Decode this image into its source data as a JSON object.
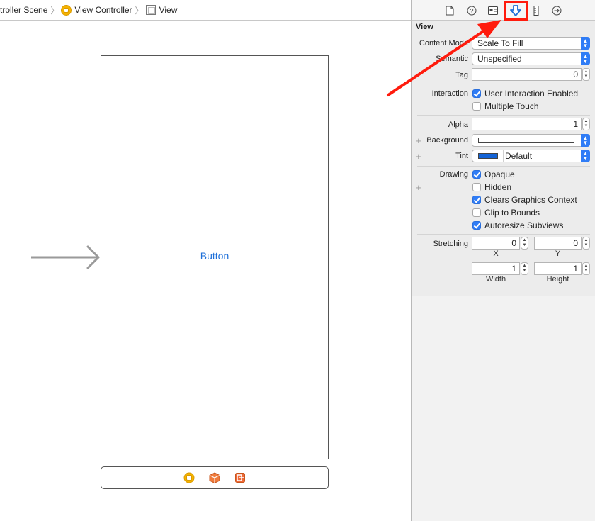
{
  "jumpbar": {
    "crumb_scene": "troller Scene",
    "crumb_vc": "View Controller",
    "crumb_view": "View",
    "separator": "〉"
  },
  "canvas": {
    "button_label": "Button"
  },
  "inspector": {
    "tabs": [
      "file-icon",
      "help-icon",
      "identity-icon",
      "attributes-icon",
      "size-icon",
      "connections-icon"
    ],
    "section_title": "View",
    "content_mode_label": "Content Mode",
    "content_mode_value": "Scale To Fill",
    "semantic_label": "Semantic",
    "semantic_value": "Unspecified",
    "tag_label": "Tag",
    "tag_value": "0",
    "interaction_label": "Interaction",
    "user_interaction_label": "User Interaction Enabled",
    "user_interaction_checked": true,
    "multiple_touch_label": "Multiple Touch",
    "multiple_touch_checked": false,
    "alpha_label": "Alpha",
    "alpha_value": "1",
    "background_label": "Background",
    "tint_label": "Tint",
    "tint_value": "Default",
    "drawing_label": "Drawing",
    "opaque_label": "Opaque",
    "opaque_checked": true,
    "hidden_label": "Hidden",
    "hidden_checked": false,
    "clears_label": "Clears Graphics Context",
    "clears_checked": true,
    "clip_label": "Clip to Bounds",
    "clip_checked": false,
    "autoresize_label": "Autoresize Subviews",
    "autoresize_checked": true,
    "stretching_label": "Stretching",
    "stretch_x": "0",
    "stretch_y": "0",
    "stretch_width": "1",
    "stretch_height": "1",
    "x_label": "X",
    "y_label": "Y",
    "width_label": "Width",
    "height_label": "Height",
    "plus": "+"
  },
  "colors": {
    "accent": "#2f7cf6",
    "highlight": "#ff1b0d",
    "link": "#1d6fd9",
    "tint_swatch": "#1463d6"
  }
}
